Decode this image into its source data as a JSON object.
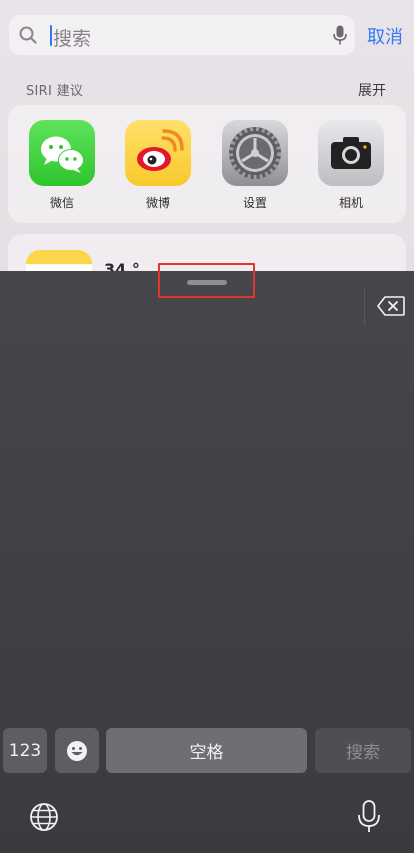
{
  "search": {
    "placeholder": "搜索",
    "cancel_label": "取消"
  },
  "siri": {
    "header": "SIRI 建议",
    "expand_label": "展开",
    "apps": [
      {
        "label": "微信",
        "icon": "wechat-icon"
      },
      {
        "label": "微博",
        "icon": "weibo-icon"
      },
      {
        "label": "设置",
        "icon": "settings-icon"
      },
      {
        "label": "相机",
        "icon": "camera-icon"
      }
    ]
  },
  "notes_card": {
    "text": "34 °"
  },
  "keyboard": {
    "numbers_label": "123",
    "emoji_icon": "emoji-icon",
    "space_label": "空格",
    "search_label": "搜索",
    "globe_icon": "globe-icon",
    "mic_icon": "mic-icon",
    "delete_icon": "delete-icon"
  },
  "colors": {
    "accent": "#3478f6",
    "highlight_box": "#e0362d",
    "keyboard_bg": "#434247"
  }
}
